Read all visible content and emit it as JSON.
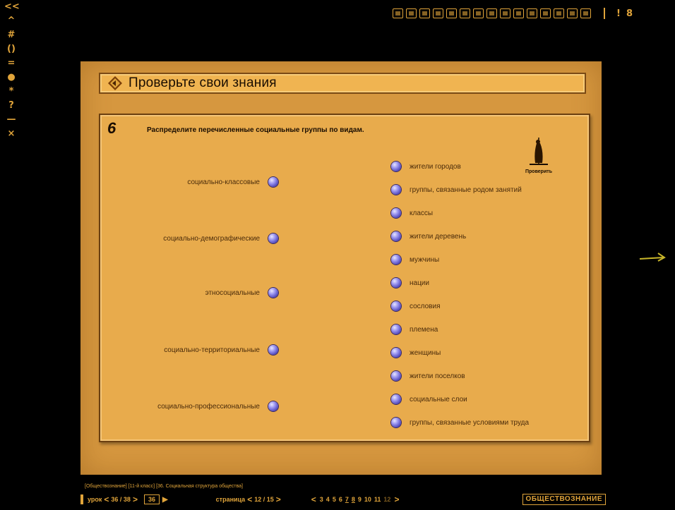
{
  "left_toolbar": [
    "<<",
    "^",
    "#",
    "()",
    "=",
    "●",
    "*",
    "?",
    "—",
    "×"
  ],
  "top_toolbar": {
    "icons": [
      "map-icon",
      "circle-icon",
      "grid-icon",
      "return-icon",
      "pencil-icon",
      "comment-icon",
      "frame-icon",
      "layers-icon",
      "tree-icon",
      "hierarchy-icon",
      "globe-icon",
      "table-icon",
      "image-icon",
      "settings-icon",
      "chat-icon"
    ],
    "glyph_1": "!",
    "glyph_2": "8"
  },
  "title": "Проверьте свои знания",
  "task": {
    "number": "6",
    "instruction": "Распределите перечисленные социальные группы по видам.",
    "check_label": "Проверить",
    "left_items": [
      "социально-классовые",
      "социально-демографические",
      "этносоциальные",
      "социально-территориальные",
      "социально-профессиональные"
    ],
    "right_items": [
      "жители городов",
      "группы, связанные родом занятий",
      "классы",
      "жители деревень",
      "мужчины",
      "нации",
      "сословия",
      "племена",
      "женщины",
      "жители поселков",
      "социальные слои",
      "группы, связанные условиями труда"
    ]
  },
  "breadcrumb": "[Обществознание] [11-й класс] [36. Социальная структура общества]",
  "bottom_bar": {
    "lesson_label": "урок",
    "lesson_prev": "<",
    "lesson_value": "36 / 38",
    "lesson_next": ">",
    "lesson_input": "36",
    "play": "▶",
    "page_label": "страница",
    "page_prev": "<",
    "page_value": "12 / 15",
    "page_next": ">",
    "pages_prev": "<",
    "pages": [
      "3",
      "4",
      "5",
      "6",
      "7",
      "8",
      "9",
      "10",
      "11",
      "12"
    ],
    "pages_next": ">",
    "subject": "ОБЩЕСТВОЗНАНИЕ"
  },
  "colors": {
    "accent": "#e0a43a",
    "panel": "#d6973f",
    "task_box": "#e8ab4c",
    "dot": "#4d45b8"
  }
}
